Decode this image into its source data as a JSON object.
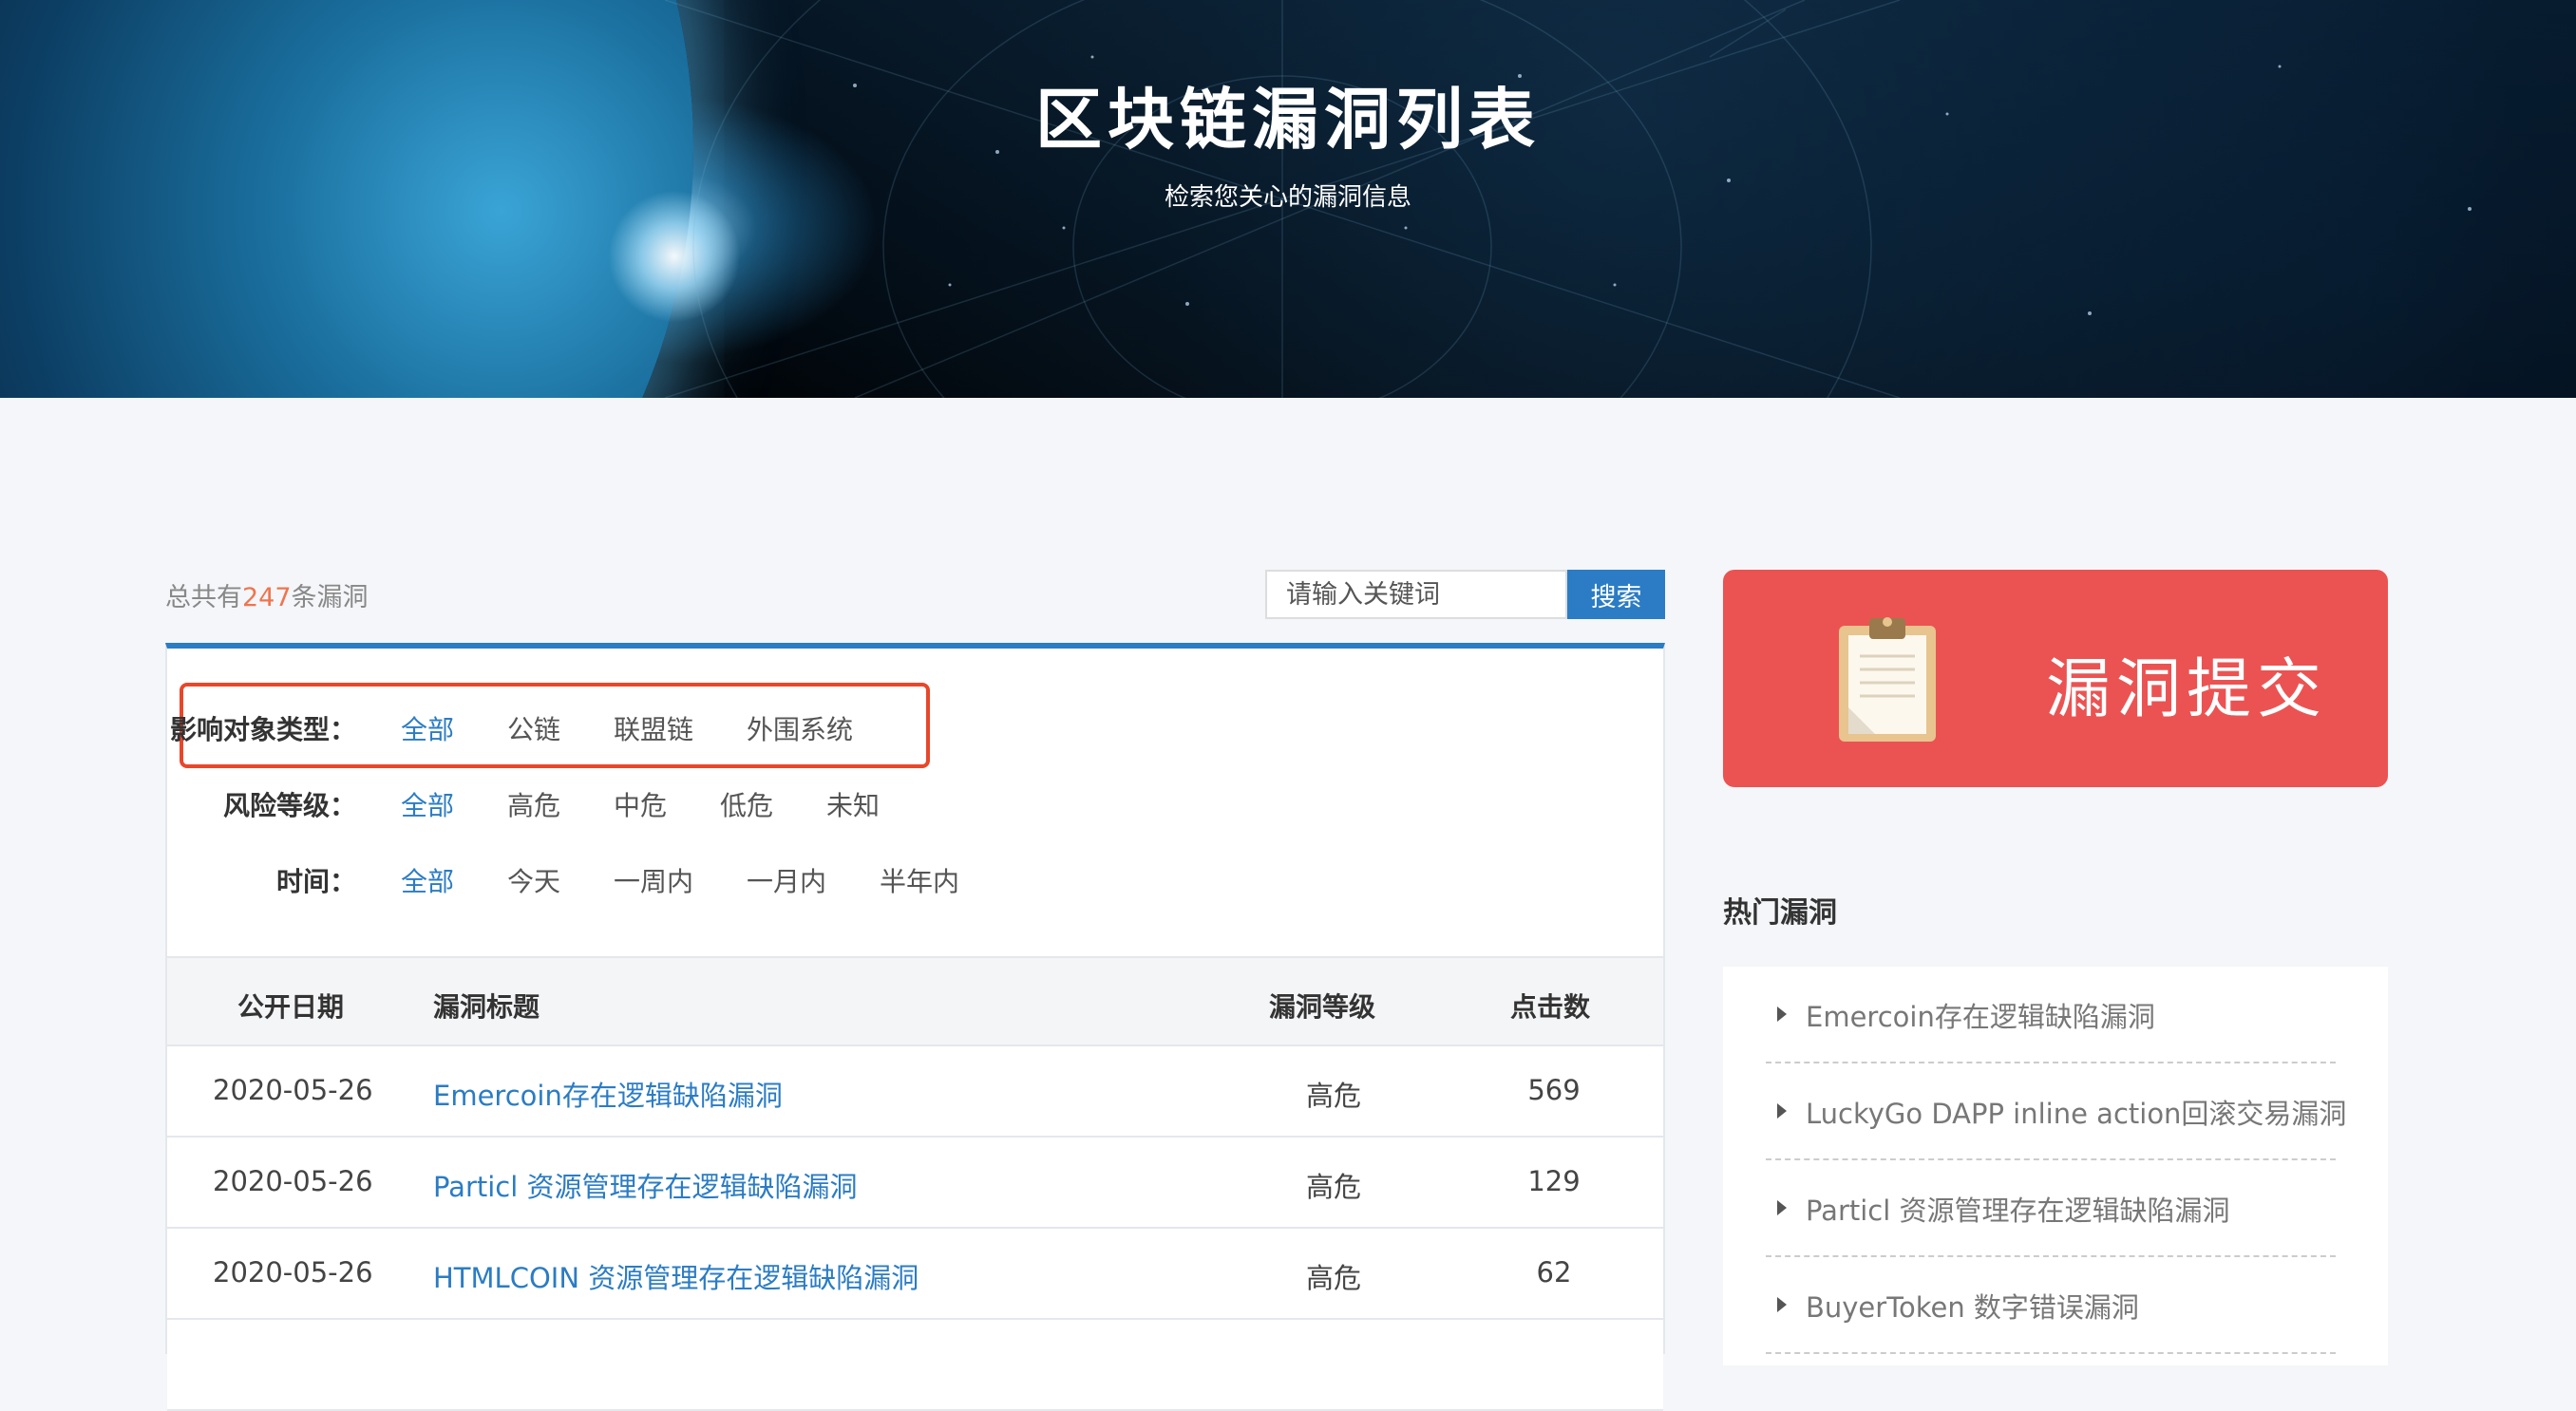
{
  "hero": {
    "title": "区块链漏洞列表",
    "subtitle": "检索您关心的漏洞信息"
  },
  "summary": {
    "prefix": "总共有",
    "count": "247",
    "suffix": "条漏洞"
  },
  "search": {
    "placeholder": "请输入关键词",
    "button": "搜索"
  },
  "filters": {
    "target_type": {
      "label": "影响对象类型：",
      "options": [
        "全部",
        "公链",
        "联盟链",
        "外围系统"
      ],
      "active": "全部"
    },
    "risk_level": {
      "label": "风险等级：",
      "options": [
        "全部",
        "高危",
        "中危",
        "低危",
        "未知"
      ],
      "active": "全部"
    },
    "time": {
      "label": "时间：",
      "options": [
        "全部",
        "今天",
        "一周内",
        "一月内",
        "半年内"
      ],
      "active": "全部"
    }
  },
  "table": {
    "headers": [
      "公开日期",
      "漏洞标题",
      "漏洞等级",
      "点击数"
    ],
    "rows": [
      {
        "date": "2020-05-26",
        "title": "Emercoin存在逻辑缺陷漏洞",
        "level": "高危",
        "clicks": "569"
      },
      {
        "date": "2020-05-26",
        "title": "Particl 资源管理存在逻辑缺陷漏洞",
        "level": "高危",
        "clicks": "129"
      },
      {
        "date": "2020-05-26",
        "title": "HTMLCOIN 资源管理存在逻辑缺陷漏洞",
        "level": "高危",
        "clicks": "62"
      }
    ]
  },
  "sidebar": {
    "submit_label": "漏洞提交",
    "hot_title": "热门漏洞",
    "hot_items": [
      "Emercoin存在逻辑缺陷漏洞",
      "LuckyGo DAPP inline action回滚交易漏洞",
      "Particl 资源管理存在逻辑缺陷漏洞",
      "BuyerToken 数字错误漏洞"
    ]
  },
  "colors": {
    "accent": "#2b7cc4",
    "highlight": "#e8472a",
    "submit_bg": "#eb5352",
    "count": "#f0744e"
  }
}
